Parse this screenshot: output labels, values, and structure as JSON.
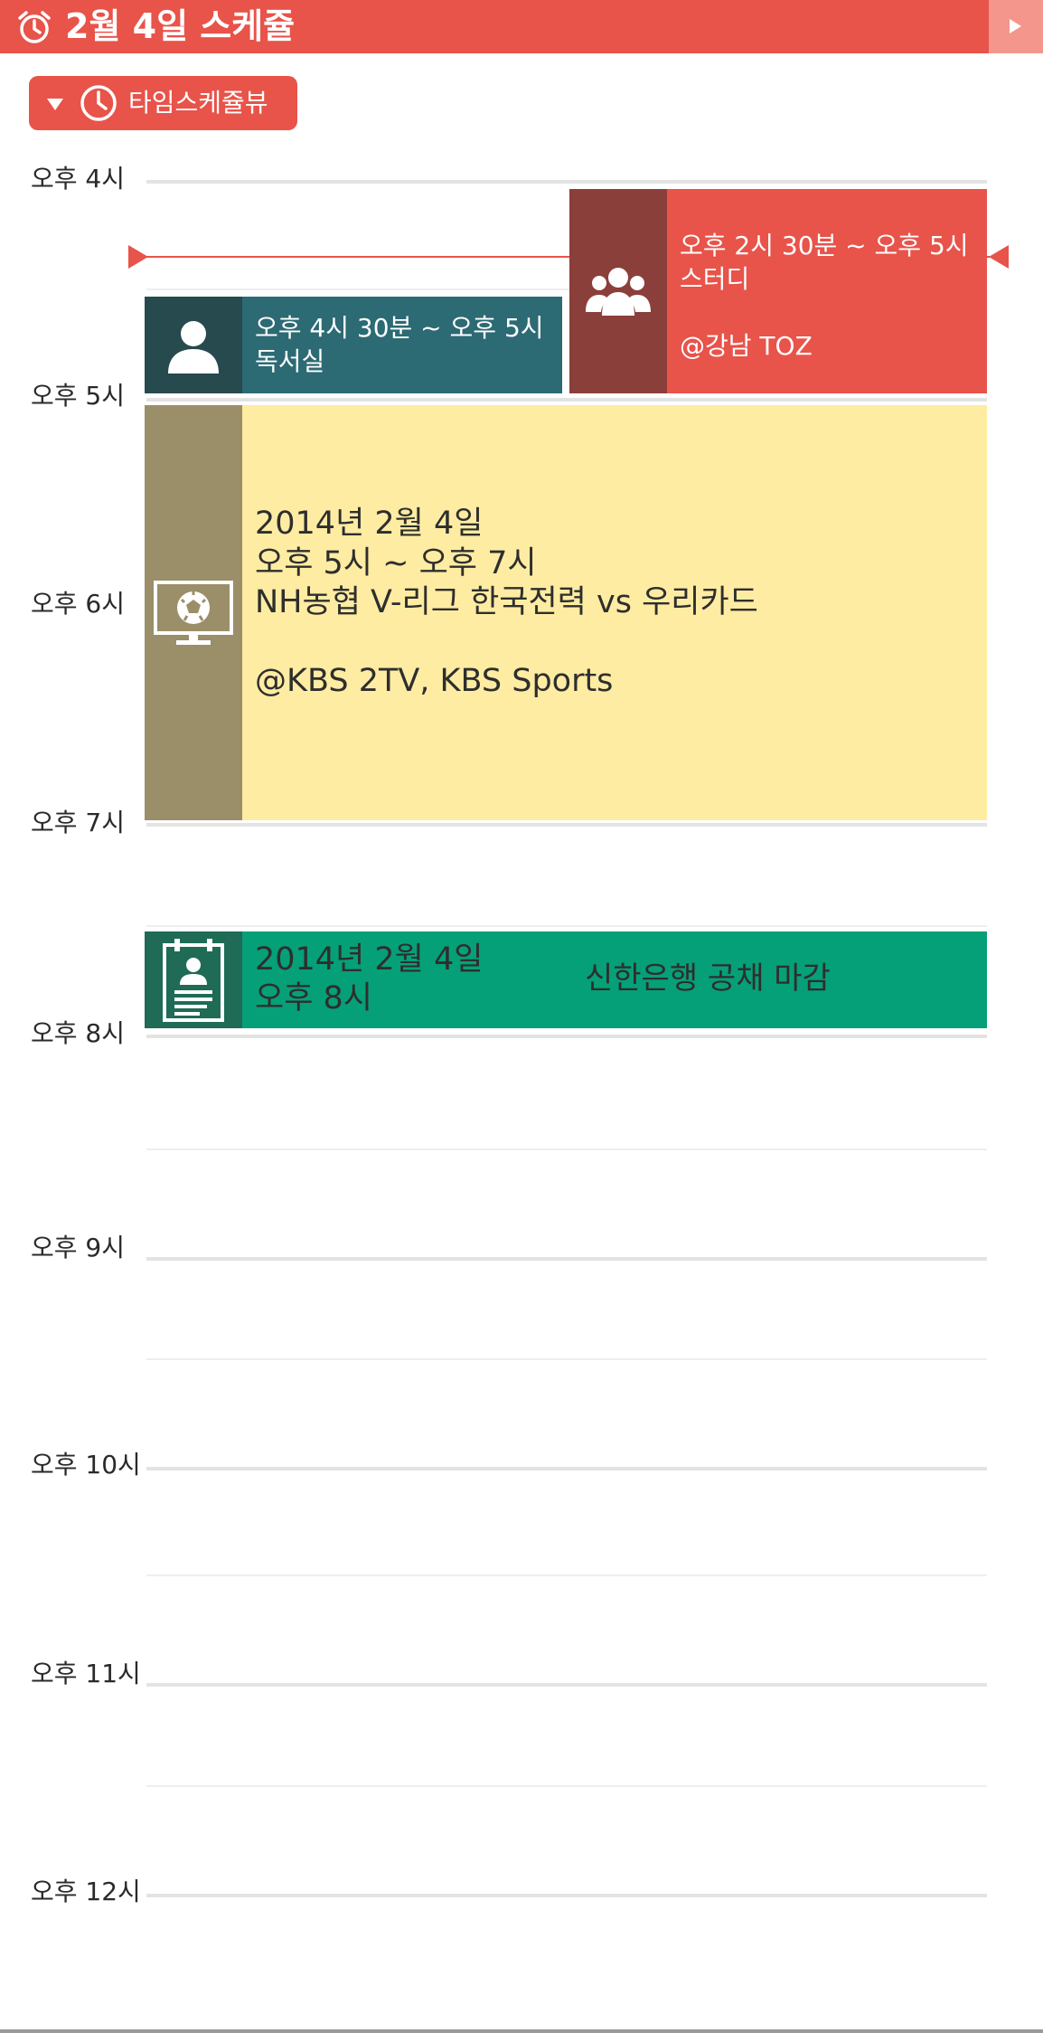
{
  "header": {
    "title": "2월 4일 스케쥴",
    "icon": "alarm-clock-icon",
    "next_icon": "play-arrow-icon",
    "background": "#e8534a"
  },
  "view_toggle": {
    "label": "타임스케쥴뷰",
    "caret_icon": "caret-down-icon",
    "clock_icon": "clock-icon"
  },
  "timeline": {
    "hour_labels": [
      "오후 4시",
      "오후 5시",
      "오후 6시",
      "오후 7시",
      "오후 8시",
      "오후 9시",
      "오후 10시",
      "오후 11시",
      "오후 12시"
    ],
    "indicator_color": "#e8534a"
  },
  "events": [
    {
      "id": "study",
      "text": "오후 2시 30분 ~ 오후  5시\n스터디\n\n@강남 TOZ",
      "icon": "group-icon",
      "color": "#e8534a",
      "icon_bg": "#8b3f3b"
    },
    {
      "id": "reading-room",
      "text": "오후 4시 30분 ~ 오후  5시\n독서실",
      "icon": "person-icon",
      "color": "#2c6a74",
      "icon_bg": "#264a4e"
    },
    {
      "id": "volleyball",
      "text": "2014년 2월 4일\n오후 5시 ~ 오후 7시\nNH농협 V-리그 한국전력 vs 우리카드\n\n@KBS 2TV, KBS Sports",
      "icon": "tv-soccer-icon",
      "color": "#feeca2",
      "icon_bg": "#9b8f69"
    },
    {
      "id": "shinhan",
      "text": "2014년 2월 4일\n오후 8시",
      "title": "신한은행 공채 마감",
      "icon": "resume-clipboard-icon",
      "color": "#05a078",
      "icon_bg": "#1f6b56"
    }
  ]
}
